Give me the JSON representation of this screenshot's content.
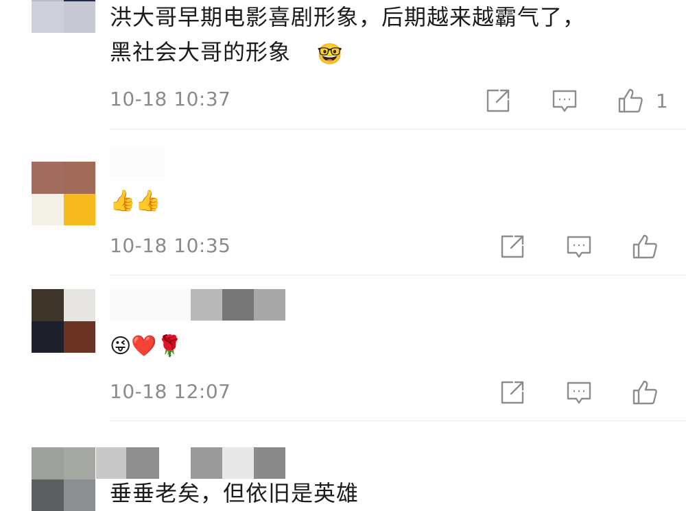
{
  "comments": [
    {
      "text": "洪大哥早期电影喜剧形象，后期越来越霸气了，\n黑社会大哥的形象",
      "emoji": "🤓",
      "time": "10-18 10:37",
      "likes": "1",
      "avatar_icon": "pixelated-avatar"
    },
    {
      "emoji": "👍👍",
      "time": "10-18 10:35",
      "avatar_icon": "pixelated-avatar"
    },
    {
      "emoji": "😜❤️🌹",
      "time": "10-18 12:07",
      "avatar_icon": "pixelated-avatar"
    },
    {
      "text": "垂垂老矣，但依旧是英雄",
      "avatar_icon": "pixelated-avatar"
    }
  ],
  "icons": {
    "share": "share-icon",
    "reply": "comment-icon",
    "like": "thumbs-up-icon"
  },
  "colors": {
    "meta_text": "#8a8a8a",
    "icon_stroke": "#8c8c8c",
    "divider": "#ececec"
  }
}
